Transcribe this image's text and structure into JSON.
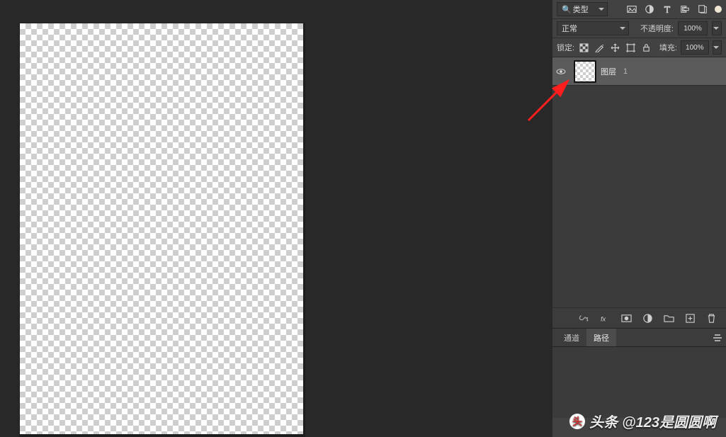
{
  "filter_row": {
    "search_label": "类型",
    "search_glyph": "🔍"
  },
  "blend_row": {
    "mode": "正常",
    "opacity_label": "不透明度:",
    "opacity_value": "100%"
  },
  "lock_row": {
    "lock_label": "锁定:",
    "fill_label": "填充:",
    "fill_value": "100%"
  },
  "layers": [
    {
      "name": "图层",
      "index": "1",
      "selected": true
    }
  ],
  "tabs": {
    "channels": "通道",
    "paths": "路径"
  },
  "watermark": {
    "prefix": "头条",
    "handle": "@123是圆圆啊"
  }
}
